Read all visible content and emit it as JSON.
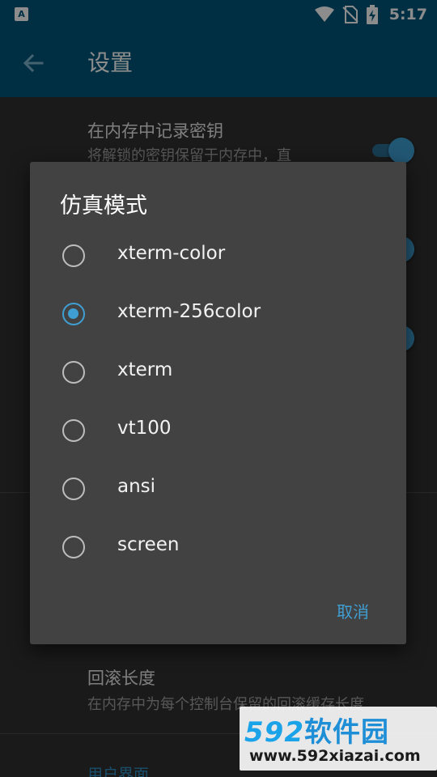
{
  "status_bar": {
    "app_icon_letter": "A",
    "time": "5:17",
    "icons": [
      "wifi-icon",
      "no-sim-icon",
      "battery-charging-icon"
    ]
  },
  "app_bar": {
    "title": "设置",
    "back_icon": "arrow-back-icon"
  },
  "settings": {
    "item1": {
      "title": "在内存中记录密钥",
      "summary": "将解锁的密钥保留于内存中，直"
    },
    "item_bottom": {
      "title": "回滚长度",
      "summary": "在内存中为每个控制台保留的回滚缓存长度"
    },
    "category_ui": "用户界面"
  },
  "dialog": {
    "title": "仿真模式",
    "options": [
      {
        "label": "xterm-color",
        "checked": false
      },
      {
        "label": "xterm-256color",
        "checked": true
      },
      {
        "label": "xterm",
        "checked": false
      },
      {
        "label": "vt100",
        "checked": false
      },
      {
        "label": "ansi",
        "checked": false
      },
      {
        "label": "screen",
        "checked": false
      }
    ],
    "cancel_label": "取消"
  },
  "watermark": {
    "brand_num": "592",
    "brand_cn": "软件园",
    "url": "www.592xiazai.com"
  },
  "colors": {
    "primary": "#00567c",
    "accent": "#3f9fd3",
    "dialog_bg": "#424242",
    "background": "#303030"
  }
}
